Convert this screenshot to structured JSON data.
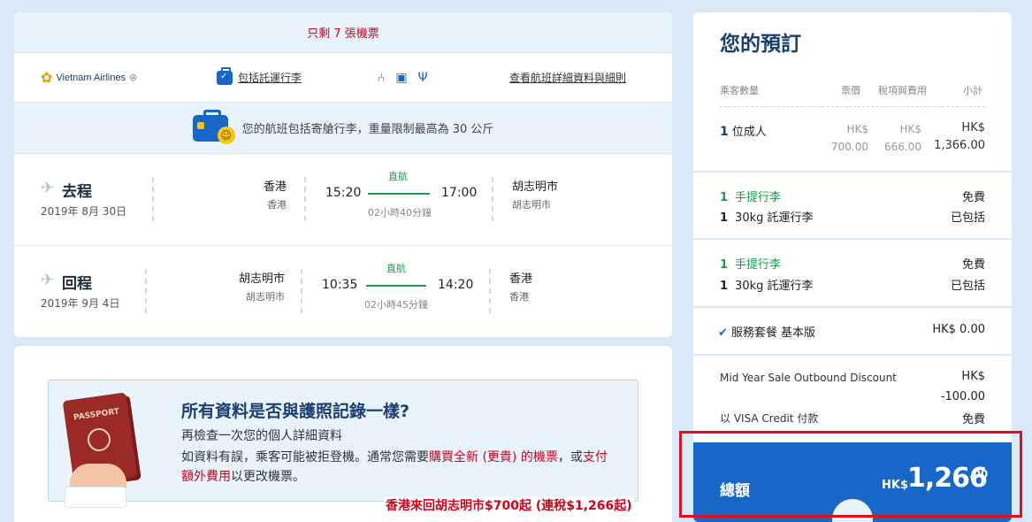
{
  "flight": {
    "seats_left": "只剩 7 張機票",
    "airline_name": "Vietnam Airlines",
    "baggage_link": "包括託運行李",
    "details_link": "查看航班詳細資料與細則",
    "bag_note": "您的航班包括寄艙行李，重量限制最高為 30 公斤",
    "legs": [
      {
        "label": "去程",
        "date": "2019年 8月 30日",
        "from_city": "香港",
        "from_sub": "香港",
        "depart": "15:20",
        "direct": "直航",
        "duration": "02小時40分鐘",
        "arrive": "17:00",
        "to_city": "胡志明市",
        "to_sub": "胡志明市"
      },
      {
        "label": "回程",
        "date": "2019年 9月 4日",
        "from_city": "胡志明市",
        "from_sub": "胡志明市",
        "depart": "10:35",
        "direct": "直航",
        "duration": "02小時45分鐘",
        "arrive": "14:20",
        "to_city": "香港",
        "to_sub": "香港"
      }
    ]
  },
  "passport": {
    "image_text": "PASSPORT",
    "title": "所有資料是否與護照記錄一樣?",
    "subtitle": "再檢查一次您的個人詳細資料",
    "warn_a": "如資料有誤，乘客可能被拒登機。通常您需要",
    "warn_red1": "購買全新 (更貴) 的機票",
    "warn_b": "，或",
    "warn_red2": "支付額外費用",
    "warn_c": "以更改機票。"
  },
  "promo": "香港來回胡志明市$700起 (連稅$1,266起)",
  "booking": {
    "title": "您的預訂",
    "headers": {
      "passengers": "乘客數量",
      "fare": "票價",
      "tax": "稅項與費用",
      "subtotal": "小計"
    },
    "adult_count": "1",
    "adult_label": "位成人",
    "fare_cur": "HK$",
    "fare": "700.00",
    "tax_cur": "HK$",
    "tax": "666.00",
    "sub_cur": "HK$",
    "subtotal": "1,366.00",
    "bags": [
      {
        "hand_count": "1",
        "hand_label": "手提行李",
        "hand_price": "免費",
        "checked_count": "1",
        "checked_label": "30kg 託運行李",
        "checked_status": "已包括"
      },
      {
        "hand_count": "1",
        "hand_label": "手提行李",
        "hand_price": "免費",
        "checked_count": "1",
        "checked_label": "30kg 託運行李",
        "checked_status": "已包括"
      }
    ],
    "service_label": "服務套餐 基本版",
    "service_price": "HK$ 0.00",
    "discount_label": "Mid Year Sale Outbound Discount",
    "discount_cur": "HK$",
    "discount_amount": "-100.00",
    "payment_label": "以 VISA Credit 付款",
    "payment_fee": "免費",
    "total_label": "總額",
    "total_cur": "HK$",
    "total_amount": "1,266",
    "total_decimal": ".00"
  },
  "colors": {
    "accent": "#1767c8",
    "alert": "#d0021b",
    "success": "#1a9a4b",
    "background": "#d9e9f7"
  },
  "icons": [
    "lotus-logo-icon",
    "skyteam-icon",
    "suitcase-icon",
    "seat-icon",
    "screen-icon",
    "meal-icon",
    "plane-depart-icon",
    "plane-return-icon",
    "check-icon"
  ]
}
